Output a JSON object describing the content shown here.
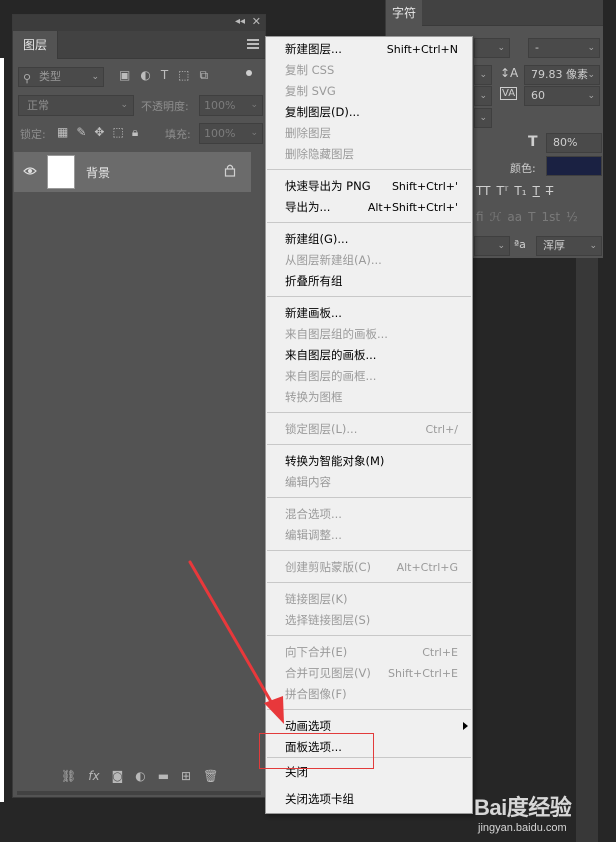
{
  "layers_panel": {
    "tab_label": "图层",
    "filter_placeholder": "类型",
    "blend_mode": "正常",
    "opacity_label": "不透明度:",
    "opacity_value": "100%",
    "lock_label": "锁定:",
    "fill_label": "填充:",
    "fill_value": "100%",
    "layer_name": "背景"
  },
  "char_panel": {
    "tab_label": "字符",
    "font_style": "-",
    "leading": "79.83 像素",
    "tracking": "60",
    "vertical_scale": "80%",
    "color_label": "颜色:",
    "antialias": "浑厚",
    "style_buttons": [
      "TT",
      "Tᵀ",
      "T₁",
      "T",
      "T"
    ],
    "style_buttons2": [
      "fi",
      "ℋ",
      "aa",
      "T",
      "1st",
      "½"
    ]
  },
  "context_menu": {
    "items": [
      {
        "label": "新建图层...",
        "shortcut": "Shift+Ctrl+N",
        "enabled": true
      },
      {
        "label": "复制 CSS",
        "shortcut": "",
        "enabled": false
      },
      {
        "label": "复制 SVG",
        "shortcut": "",
        "enabled": false
      },
      {
        "label": "复制图层(D)...",
        "shortcut": "",
        "enabled": true
      },
      {
        "label": "删除图层",
        "shortcut": "",
        "enabled": false
      },
      {
        "label": "删除隐藏图层",
        "shortcut": "",
        "enabled": false
      },
      {
        "label": "快速导出为 PNG",
        "shortcut": "Shift+Ctrl+'",
        "enabled": true
      },
      {
        "label": "导出为...",
        "shortcut": "Alt+Shift+Ctrl+'",
        "enabled": true
      },
      {
        "label": "新建组(G)...",
        "shortcut": "",
        "enabled": true
      },
      {
        "label": "从图层新建组(A)...",
        "shortcut": "",
        "enabled": false
      },
      {
        "label": "折叠所有组",
        "shortcut": "",
        "enabled": true
      },
      {
        "label": "新建画板...",
        "shortcut": "",
        "enabled": true
      },
      {
        "label": "来自图层组的画板...",
        "shortcut": "",
        "enabled": false
      },
      {
        "label": "来自图层的画板...",
        "shortcut": "",
        "enabled": true
      },
      {
        "label": "来自图层的画框...",
        "shortcut": "",
        "enabled": false
      },
      {
        "label": "转换为图框",
        "shortcut": "",
        "enabled": false
      },
      {
        "label": "锁定图层(L)...",
        "shortcut": "Ctrl+/",
        "enabled": false
      },
      {
        "label": "转换为智能对象(M)",
        "shortcut": "",
        "enabled": true
      },
      {
        "label": "编辑内容",
        "shortcut": "",
        "enabled": false
      },
      {
        "label": "混合选项...",
        "shortcut": "",
        "enabled": false
      },
      {
        "label": "编辑调整...",
        "shortcut": "",
        "enabled": false
      },
      {
        "label": "创建剪贴蒙版(C)",
        "shortcut": "Alt+Ctrl+G",
        "enabled": false
      },
      {
        "label": "链接图层(K)",
        "shortcut": "",
        "enabled": false
      },
      {
        "label": "选择链接图层(S)",
        "shortcut": "",
        "enabled": false
      },
      {
        "label": "向下合并(E)",
        "shortcut": "Ctrl+E",
        "enabled": false
      },
      {
        "label": "合并可见图层(V)",
        "shortcut": "Shift+Ctrl+E",
        "enabled": false
      },
      {
        "label": "拼合图像(F)",
        "shortcut": "",
        "enabled": false
      },
      {
        "label": "动画选项",
        "shortcut": "",
        "enabled": true
      },
      {
        "label": "面板选项...",
        "shortcut": "",
        "enabled": true
      },
      {
        "label": "关闭",
        "shortcut": "",
        "enabled": true
      },
      {
        "label": "关闭选项卡组",
        "shortcut": "",
        "enabled": true
      }
    ]
  },
  "watermark": {
    "brand": "Bai度经验",
    "url": "jingyan.baidu.com"
  },
  "colors": {
    "panel_bg": "#535353",
    "menu_bg": "#f0f0f0",
    "highlight": "#e23b3b",
    "swatch": "#1a2142"
  }
}
